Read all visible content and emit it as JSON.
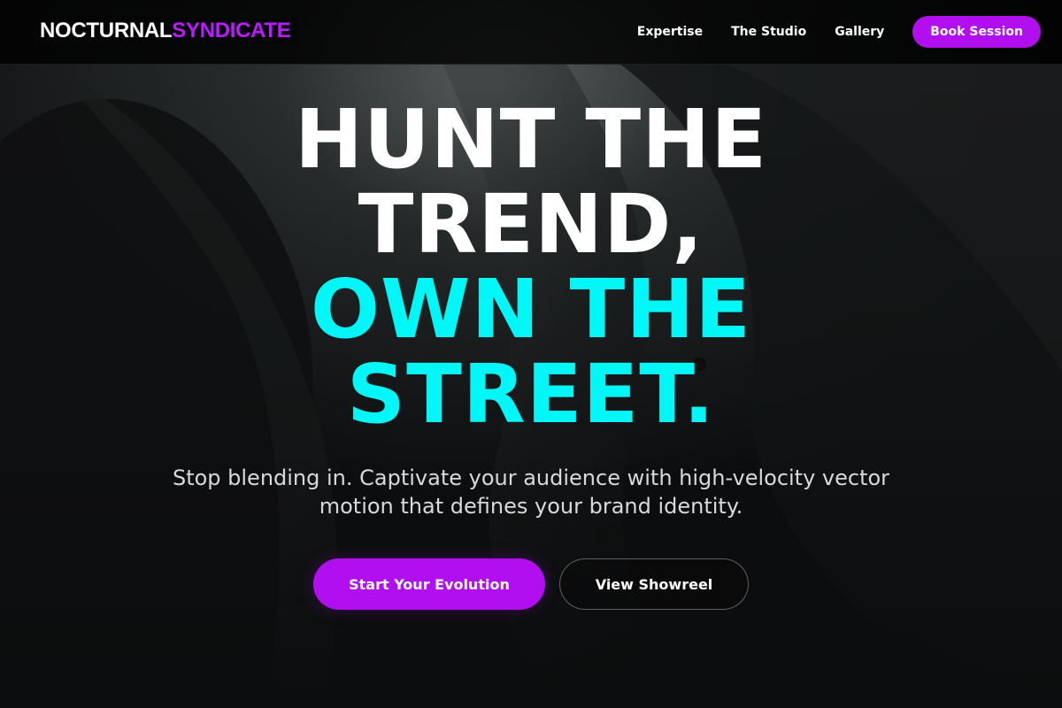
{
  "brand": {
    "name_part_a": "NOCTURNAL",
    "name_part_b": "SYNDICATE"
  },
  "nav": {
    "links": [
      "Expertise",
      "The Studio",
      "Gallery"
    ],
    "cta": "Book Session"
  },
  "hero": {
    "headline_lines": [
      "HUNT THE",
      "TREND,",
      "OWN THE",
      "STREET."
    ],
    "subtext": "Stop blending in. Captivate your audience with high-velocity vector motion that defines your brand identity.",
    "primary_cta": "Start Your Evolution",
    "secondary_cta": "View Showreel"
  },
  "colors": {
    "accent_purple": "#b20ff0",
    "accent_cyan": "#00f7f7",
    "background": "#0c0d0e"
  }
}
